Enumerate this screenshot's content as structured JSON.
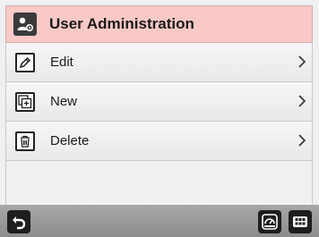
{
  "header": {
    "title": "User Administration",
    "icon": "user-admin-icon",
    "background": "#f9c9c7"
  },
  "menu": {
    "items": [
      {
        "label": "Edit",
        "icon": "edit-icon"
      },
      {
        "label": "New",
        "icon": "new-icon"
      },
      {
        "label": "Delete",
        "icon": "delete-icon"
      }
    ]
  },
  "footer": {
    "buttons": [
      "back-icon",
      "dashboard-icon",
      "apps-grid-icon"
    ]
  }
}
